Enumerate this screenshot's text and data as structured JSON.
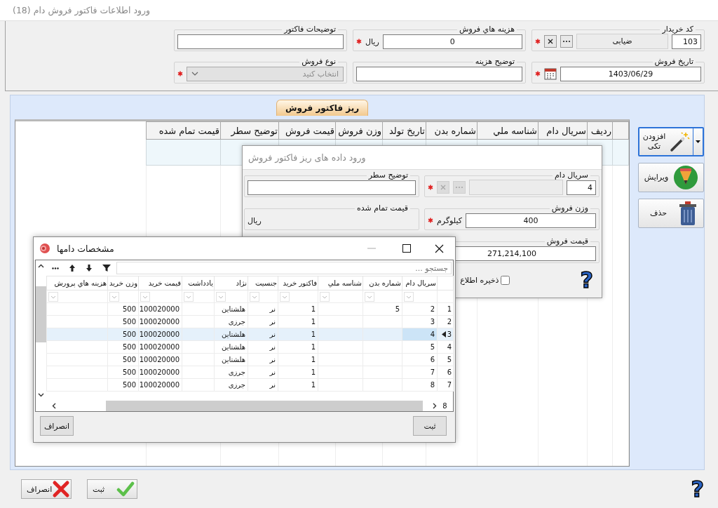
{
  "window": {
    "title": "ورود اطلاعات فاکتور فروش دام (18)"
  },
  "header_fields": [
    {
      "kind": "lookup",
      "label": "كد خريدار",
      "value": "103",
      "display": "ضیابی",
      "disabled": false,
      "required": true
    },
    {
      "kind": "unit",
      "label": "هزینه هاي فروش",
      "value": "0",
      "unit": "ریال",
      "required": true
    },
    {
      "kind": "text",
      "label": "توضیحات فاکتور"
    },
    {
      "kind": "date",
      "label": "تاریخ فروش",
      "value": "1403/06/29",
      "required": true
    },
    {
      "kind": "text",
      "label": "توضیح هزینه"
    },
    {
      "kind": "select",
      "label": "نوع فروش",
      "placeholder": "انتخاب کنید",
      "disabled": true,
      "required": true
    }
  ],
  "details_tab": {
    "label": "ریز فاکتور فروش",
    "selected": true
  },
  "details_grid": {
    "columns": [
      "ردیف",
      "سريال دام",
      "شناسه ملي",
      "شماره بدن",
      "تاریخ تولد",
      "وزن فروش",
      "قيمت فروش",
      "توضیح سطر",
      "قیمت تمام شده"
    ]
  },
  "side_buttons": [
    {
      "kind": "add",
      "label": "افزودن تکی",
      "focused": true,
      "dropdown": true
    },
    {
      "kind": "edit",
      "label": "ویرایش",
      "focused": false,
      "dropdown": false
    },
    {
      "kind": "delete",
      "label": "حذف",
      "focused": false,
      "dropdown": false
    }
  ],
  "footer_buttons": [
    {
      "kind": "save",
      "label": "ثبت"
    },
    {
      "kind": "cancel",
      "label": "انصراف"
    }
  ],
  "help": "?",
  "entry_dialog": {
    "title": "ورود داده های ریز فاکتور فروش",
    "fields": [
      {
        "kind": "lookup",
        "label": "سريال دام",
        "value": "4",
        "disabled": true,
        "required": true
      },
      {
        "kind": "text",
        "label": "توضیح سطر"
      },
      {
        "kind": "unit",
        "label": "وزن فروش",
        "value": "400",
        "unit": "کیلوگرم",
        "required": true
      },
      {
        "kind": "label",
        "label": "قیمت تمام شده",
        "unit": "ریال"
      },
      {
        "kind": "text",
        "label": "قیمت فروش",
        "value": "271,214,100"
      }
    ],
    "checkbox": {
      "label": "ذخیره اطلاع",
      "checked": false
    },
    "help": "?"
  },
  "herd_dialog": {
    "title": "مشخصات دامها",
    "search": {
      "placeholder": "جستجو ..."
    },
    "columns": [
      "سريال دام",
      "شماره بدن",
      "شناسه ملي",
      "فاکتور خرید",
      "جنسیت",
      "نژاد",
      "یادداشت",
      "قيمت خرید",
      "وزن خرید",
      "هزینه هاي پرورش"
    ],
    "rows": [
      {
        "number": "1",
        "cells": [
          "2",
          "5",
          null,
          "1",
          "نر",
          "هلشتاین",
          null,
          "100020000",
          "500",
          null
        ],
        "selected": false
      },
      {
        "number": "2",
        "cells": [
          "3",
          null,
          null,
          "1",
          "نر",
          "جرزی",
          null,
          "100020000",
          "500",
          null
        ],
        "selected": false
      },
      {
        "number": "3",
        "cells": [
          "4",
          null,
          null,
          "1",
          "نر",
          "هلشتاین",
          null,
          "100020000",
          "500",
          null
        ],
        "selected": true
      },
      {
        "number": "4",
        "cells": [
          "5",
          null,
          null,
          "1",
          "نر",
          "هلشتاین",
          null,
          "100020000",
          "500",
          null
        ],
        "selected": false
      },
      {
        "number": "5",
        "cells": [
          "6",
          null,
          null,
          "1",
          "نر",
          "هلشتاین",
          null,
          "100020000",
          "500",
          null
        ],
        "selected": false
      },
      {
        "number": "6",
        "cells": [
          "7",
          null,
          null,
          "1",
          "نر",
          "جرزی",
          null,
          "100020000",
          "500",
          null
        ],
        "selected": false
      },
      {
        "number": "7",
        "cells": [
          "8",
          null,
          null,
          "1",
          "نر",
          "جرزی",
          null,
          "100020000",
          "500",
          null
        ],
        "selected": false
      }
    ],
    "record_count": "8",
    "buttons": [
      "ثبت",
      "انصراف"
    ]
  }
}
